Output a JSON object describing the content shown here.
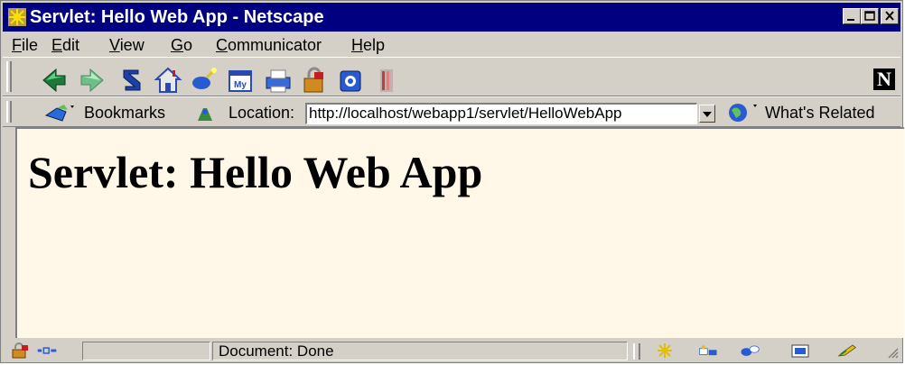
{
  "window": {
    "title": "Servlet: Hello Web App - Netscape",
    "controls": [
      "minimize",
      "maximize",
      "close"
    ]
  },
  "menu": [
    {
      "label": "File",
      "accesskey": "F"
    },
    {
      "label": "Edit",
      "accesskey": "E"
    },
    {
      "label": "View",
      "accesskey": "V"
    },
    {
      "label": "Go",
      "accesskey": "G"
    },
    {
      "label": "Communicator",
      "accesskey": "C"
    },
    {
      "label": "Help",
      "accesskey": "H"
    }
  ],
  "navigation_toolbar": {
    "buttons": [
      "back-icon",
      "forward-icon",
      "reload-icon",
      "home-icon",
      "search-icon",
      "my-netscape-icon",
      "print-icon",
      "security-icon",
      "shop-icon",
      "stop-icon"
    ],
    "brand_icon": "N"
  },
  "location_toolbar": {
    "bookmarks_label": "Bookmarks",
    "location_label": "Location:",
    "url": "http://localhost/webapp1/servlet/HelloWebApp",
    "whats_related_label": "What's Related"
  },
  "page": {
    "heading": "Servlet: Hello Web App",
    "background": "#fff7e8"
  },
  "status_bar": {
    "status_text": "Document: Done",
    "icons": [
      "lock-icon",
      "connection-icon",
      "navigator-icon",
      "mail-icon",
      "newsgroups-icon",
      "composer-icon",
      "edit-icon"
    ]
  },
  "colors": {
    "titlebar": "#000080",
    "chrome": "#d4d0c8"
  }
}
